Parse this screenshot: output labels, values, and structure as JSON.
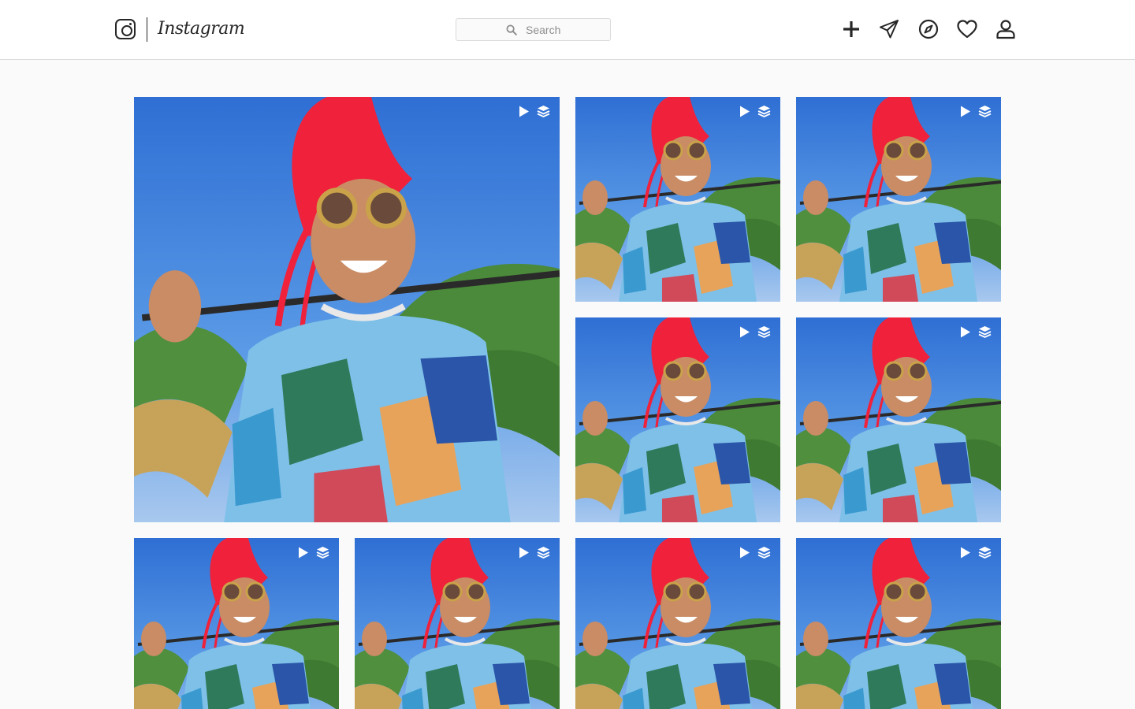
{
  "header": {
    "brand": "Instagram",
    "search_placeholder": "Search",
    "nav": [
      {
        "icon": "plus-icon",
        "label": "New post"
      },
      {
        "icon": "send-icon",
        "label": "Direct"
      },
      {
        "icon": "compass-icon",
        "label": "Explore"
      },
      {
        "icon": "heart-icon",
        "label": "Activity"
      },
      {
        "icon": "profile-icon",
        "label": "Profile"
      }
    ]
  },
  "grid": {
    "tiles": [
      {
        "featured": true,
        "badges": [
          "play-icon",
          "carousel-icon"
        ]
      },
      {
        "featured": false,
        "badges": [
          "play-icon",
          "carousel-icon"
        ]
      },
      {
        "featured": false,
        "badges": [
          "play-icon",
          "carousel-icon"
        ]
      },
      {
        "featured": false,
        "badges": [
          "play-icon",
          "carousel-icon"
        ]
      },
      {
        "featured": false,
        "badges": [
          "play-icon",
          "carousel-icon"
        ]
      },
      {
        "featured": false,
        "badges": [
          "play-icon",
          "carousel-icon"
        ]
      },
      {
        "featured": false,
        "badges": [
          "play-icon",
          "carousel-icon"
        ]
      },
      {
        "featured": false,
        "badges": [
          "play-icon",
          "carousel-icon"
        ]
      },
      {
        "featured": false,
        "badges": [
          "play-icon",
          "carousel-icon"
        ]
      }
    ]
  },
  "colors": {
    "page_background": "#fafafa",
    "header_background": "#ffffff",
    "border": "#dbdbdb",
    "icon": "#262626",
    "placeholder_text": "#8e8e8e",
    "sky": "#3a7fd6",
    "hair": "#f0213b",
    "foliage": "#4a8a3a"
  }
}
